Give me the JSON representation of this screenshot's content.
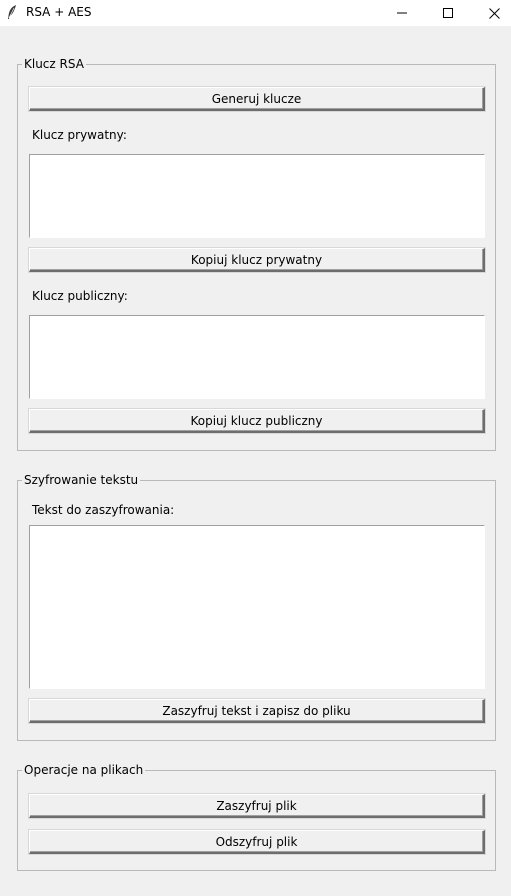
{
  "window": {
    "title": "RSA + AES",
    "icon": "feather-icon"
  },
  "rsa_group": {
    "title": "Klucz RSA",
    "generate_button": "Generuj klucze",
    "private_key_label": "Klucz prywatny:",
    "private_key_value": "",
    "copy_private_button": "Kopiuj klucz prywatny",
    "public_key_label": "Klucz publiczny:",
    "public_key_value": "",
    "copy_public_button": "Kopiuj klucz publiczny"
  },
  "text_group": {
    "title": "Szyfrowanie tekstu",
    "text_label": "Tekst do zaszyfrowania:",
    "text_value": "",
    "encrypt_button": "Zaszyfruj tekst i zapisz do pliku"
  },
  "files_group": {
    "title": "Operacje na plikach",
    "encrypt_file_button": "Zaszyfruj plik",
    "decrypt_file_button": "Odszyfruj plik"
  }
}
